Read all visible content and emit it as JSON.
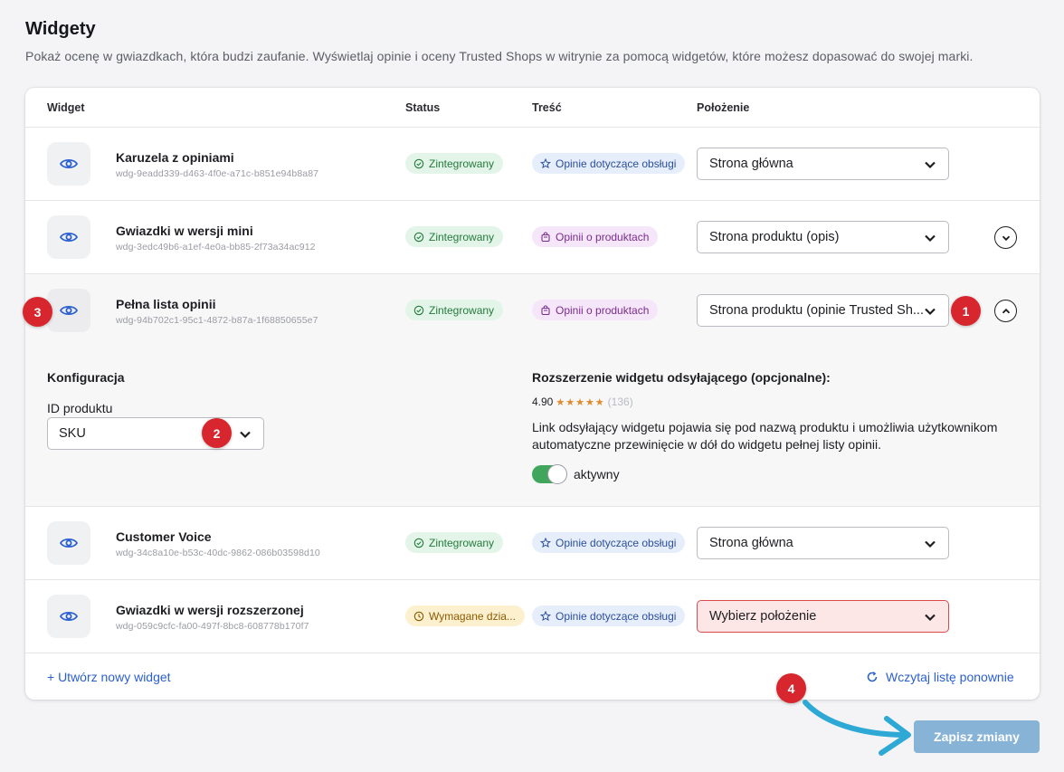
{
  "page": {
    "title": "Widgety",
    "subtitle": "Pokaż ocenę w gwiazdkach, która budzi zaufanie. Wyświetlaj opinie i oceny Trusted Shops w witrynie za pomocą widgetów, które możesz dopasować do swojej marki."
  },
  "table": {
    "headers": {
      "widget": "Widget",
      "status": "Status",
      "content": "Treść",
      "position": "Położenie"
    },
    "rows": [
      {
        "name": "Karuzela z opiniami",
        "id": "wdg-9eadd339-d463-4f0e-a71c-b851e94b8a87",
        "status": "Zintegrowany",
        "content": "Opinie dotyczące obsługi",
        "position": "Strona główna"
      },
      {
        "name": "Gwiazdki w wersji mini",
        "id": "wdg-3edc49b6-a1ef-4e0a-bb85-2f73a34ac912",
        "status": "Zintegrowany",
        "content": "Opinii o produktach",
        "position": "Strona produktu (opis)"
      },
      {
        "name": "Pełna lista opinii",
        "id": "wdg-94b702c1-95c1-4872-b87a-1f68850655e7",
        "status": "Zintegrowany",
        "content": "Opinii o produktach",
        "position": "Strona produktu (opinie Trusted Sh..."
      },
      {
        "name": "Customer Voice",
        "id": "wdg-34c8a10e-b53c-40dc-9862-086b03598d10",
        "status": "Zintegrowany",
        "content": "Opinie dotyczące obsługi",
        "position": "Strona główna"
      },
      {
        "name": "Gwiazdki w wersji rozszerzonej",
        "id": "wdg-059c9cfc-fa00-497f-8bc8-608778b170f7",
        "status": "Wymagane dzia...",
        "content": "Opinie dotyczące obsługi",
        "position": "Wybierz położenie"
      }
    ]
  },
  "config": {
    "title": "Konfiguracja",
    "product_id_label": "ID produktu",
    "product_id_value": "SKU",
    "extension_title": "Rozszerzenie widgetu odsyłającego (opcjonalne):",
    "rating_value": "4.90",
    "rating_stars": "★★★★★",
    "rating_count": "(136)",
    "extension_desc": "Link odsyłający widgetu pojawia się pod nazwą produktu i umożliwia użytkownikom automatyczne przewinięcie w dół do widgetu pełnej listy opinii.",
    "toggle_label": "aktywny",
    "toggle_on": true
  },
  "footer": {
    "create_link": "+ Utwórz nowy widget",
    "reload_link": "Wczytaj listę ponownie",
    "save_button": "Zapisz zmiany"
  },
  "markers": [
    "1",
    "2",
    "3",
    "4"
  ],
  "colors": {
    "accent": "#2a5fd0",
    "marker": "#d7262e",
    "save_button": "#86b3d6",
    "arrow": "#2ea9d6"
  }
}
